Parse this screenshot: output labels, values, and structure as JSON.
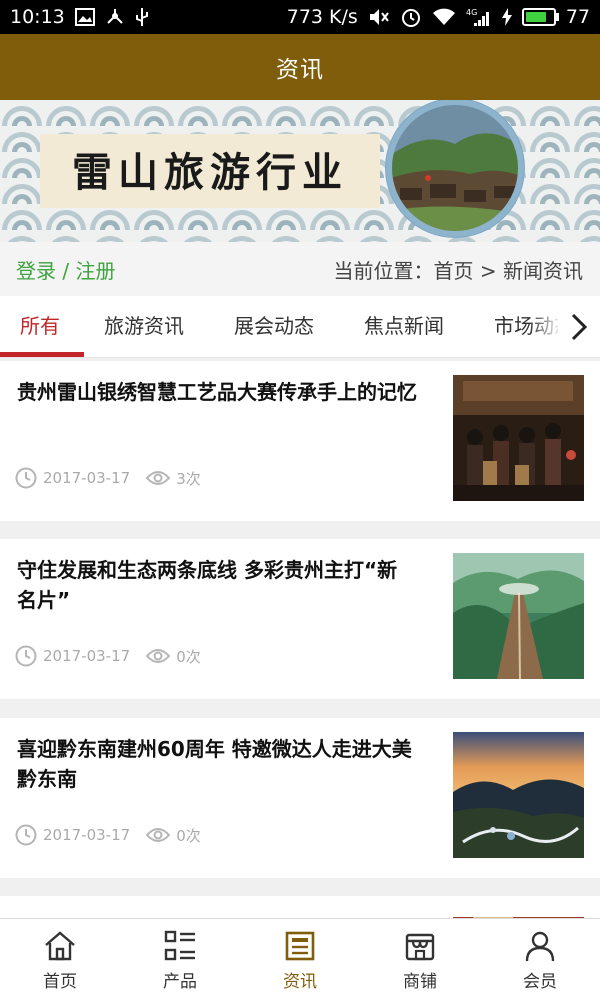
{
  "status_bar": {
    "time": "10:13",
    "speed": "773 K/s",
    "network": "4G",
    "battery": "77",
    "battery_level": 0.77
  },
  "header": {
    "title": "资讯"
  },
  "banner": {
    "text": "雷山旅游行业"
  },
  "user_bar": {
    "login_label": "登录 / 注册",
    "location_label": "当前位置：首页 > 新闻资讯"
  },
  "tabs": [
    "所有",
    "旅游资讯",
    "展会动态",
    "焦点新闻",
    "市场动态"
  ],
  "news": [
    {
      "title": "贵州雷山银绣智慧工艺品大赛传承手上的记忆",
      "date": "2017-03-17",
      "views": "3次",
      "image": "performance-photo"
    },
    {
      "title": "守住发展和生态两条底线 多彩贵州主打“新名片”",
      "date": "2017-03-17",
      "views": "0次",
      "image": "bridge-aerial-photo"
    },
    {
      "title": "喜迎黔东南建州60周年 特邀微达人走进大美黔东南",
      "date": "2017-03-17",
      "views": "0次",
      "image": "sunset-valley-photo"
    }
  ],
  "bottom_nav": [
    {
      "label": "首页",
      "icon": "home-icon"
    },
    {
      "label": "产品",
      "icon": "grid-list-icon"
    },
    {
      "label": "资讯",
      "icon": "document-icon",
      "active": true
    },
    {
      "label": "商铺",
      "icon": "store-icon"
    },
    {
      "label": "会员",
      "icon": "user-icon"
    }
  ],
  "colors": {
    "header_bg": "#7f5d0b",
    "accent_red": "#c0262a",
    "login_green": "#3fa33f"
  }
}
